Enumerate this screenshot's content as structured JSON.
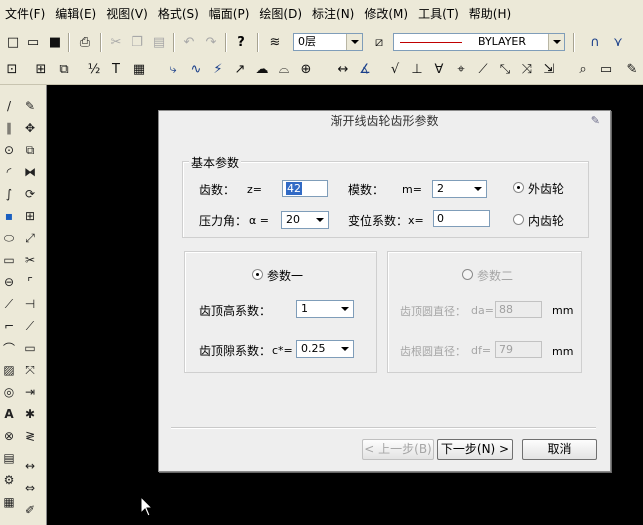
{
  "menu": [
    {
      "label": "文件(F)"
    },
    {
      "label": "编辑(E)"
    },
    {
      "label": "视图(V)"
    },
    {
      "label": "格式(S)"
    },
    {
      "label": "幅面(P)"
    },
    {
      "label": "绘图(D)"
    },
    {
      "label": "标注(N)"
    },
    {
      "label": "修改(M)"
    },
    {
      "label": "工具(T)"
    },
    {
      "label": "帮助(H)"
    }
  ],
  "toolbar": {
    "layer_value": "0层",
    "linetype_value": "BYLAYER",
    "linetype_color": "#c00000",
    "help_icon_glyph": "?"
  },
  "dialog": {
    "title": "渐开线齿轮齿形参数",
    "basic": {
      "legend": "基本参数",
      "teeth_label": "齿数：",
      "teeth_symbol": "z=",
      "teeth_value": "42",
      "module_label": "模数：",
      "module_symbol": "m=",
      "module_value": "2",
      "external_label": "外齿轮",
      "pressure_angle_label": "压力角：",
      "pressure_angle_symbol": "α =",
      "pressure_angle_value": "20",
      "shift_label": "变位系数：",
      "shift_symbol": "x=",
      "shift_value": "0",
      "internal_label": "内齿轮"
    },
    "param1": {
      "radio_label": "参数一",
      "addendum_label": "齿顶高系数：",
      "addendum_value": "1",
      "clearance_label": "齿顶隙系数：",
      "clearance_symbol": "c*=",
      "clearance_value": "0.25"
    },
    "param2": {
      "radio_label": "参数二",
      "tip_diameter_label": "齿顶圆直径：",
      "tip_diameter_symbol": "da=",
      "tip_diameter_value": "88",
      "root_diameter_label": "齿根圆直径：",
      "root_diameter_symbol": "df=",
      "root_diameter_value": "79",
      "unit": "mm"
    },
    "buttons": {
      "prev": "< 上一步(B)",
      "next": "下一步(N) >",
      "cancel": "取消"
    }
  }
}
